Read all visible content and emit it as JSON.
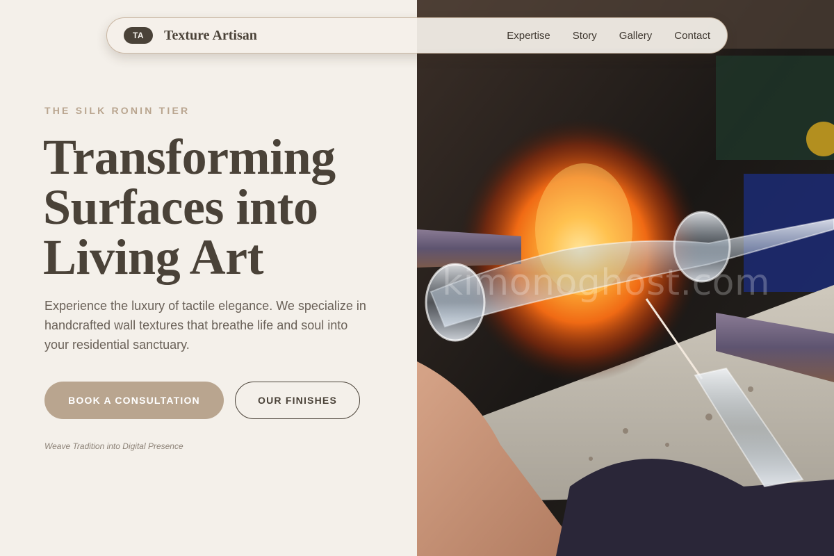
{
  "nav": {
    "logo_initials": "TA",
    "brand_name": "Texture Artisan",
    "links": [
      {
        "label": "Expertise"
      },
      {
        "label": "Story"
      },
      {
        "label": "Gallery"
      },
      {
        "label": "Contact"
      }
    ]
  },
  "hero": {
    "eyebrow": "THE SILK RONIN TIER",
    "headline_lines": [
      "Transforming",
      "Surfaces into",
      "Living Art"
    ],
    "lead": "Experience the luxury of tactile elegance. We specialize in handcrafted wall textures that breathe life and soul into your residential sanctuary.",
    "primary_button": "BOOK A CONSULTATION",
    "secondary_button": "OUR FINISHES",
    "tagline": "Weave Tradition into Digital Presence"
  },
  "image": {
    "watermark": "kimonoghost.com"
  },
  "colors": {
    "background": "#f4f0ea",
    "text_dark": "#4a4238",
    "accent": "#b9a58f",
    "body_text": "#6a6158"
  }
}
